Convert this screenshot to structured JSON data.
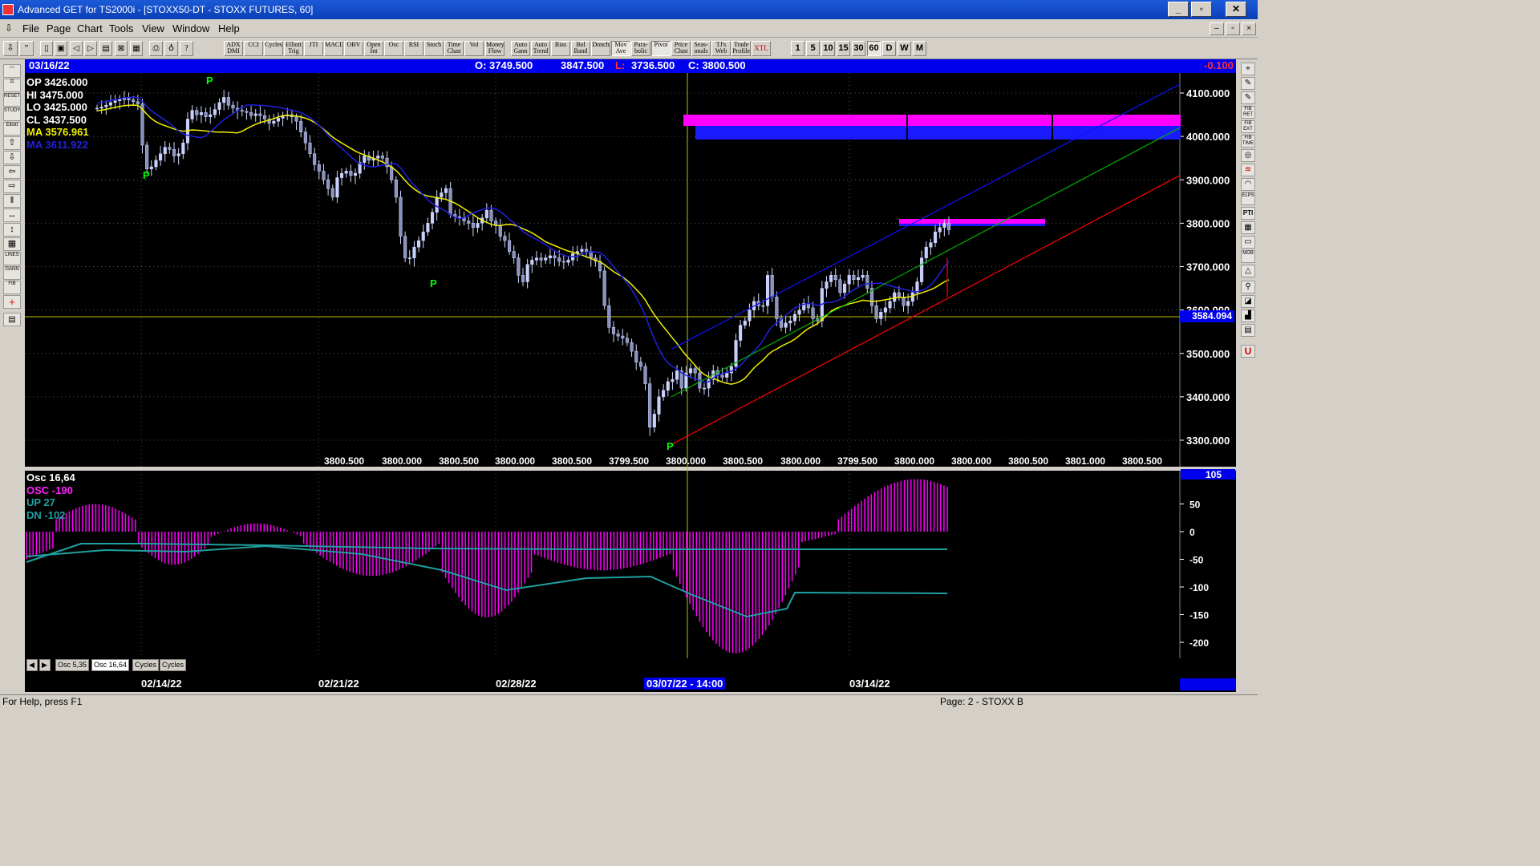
{
  "window": {
    "title": "Advanced GET for TS2000i - [STOXX50-DT - STOXX FUTURES, 60]"
  },
  "menu": [
    "File",
    "Page",
    "Chart",
    "Tools",
    "View",
    "Window",
    "Help"
  ],
  "toolbar": {
    "studies": [
      "ADX DMI",
      "CCI",
      "Cycles",
      "Elliott Trig",
      "JTI",
      "MACD",
      "OBV",
      "Open Int",
      "Osc",
      "RSI",
      "Stoch",
      "Time Clust",
      "Vol",
      "Money Flow",
      "Auto Gann",
      "Auto Trend",
      "Bias",
      "Bol Band",
      "Donch",
      "Mov Ave",
      "Para-bolic",
      "Pivot",
      "Price Clust",
      "Seas-onals",
      "TJ's Web",
      "Trade Profile",
      "XTL"
    ],
    "intervals": [
      "1",
      "5",
      "10",
      "15",
      "30",
      "60",
      "D",
      "W",
      "M"
    ],
    "selected_interval": "60"
  },
  "infobar": {
    "date": "03/16/22",
    "open": "O: 3749.500",
    "high": "3847.500",
    "low_label": "L:",
    "low": "3736.500",
    "close": "C: 3800.500",
    "change": "-0.100"
  },
  "legend": {
    "op": "OP  3426.000",
    "hi": "HI   3475.000",
    "lo": "LO  3425.000",
    "cl": "CL  3437.500",
    "ma1": "MA  3576.961",
    "ma2": "MA  3611.922"
  },
  "price_axis": {
    "ticks": [
      "4100.000",
      "4000.000",
      "3900.000",
      "3800.000",
      "3700.000",
      "3600.000",
      "3500.000",
      "3400.000",
      "3300.000"
    ],
    "cursor_value": "3584.094"
  },
  "bottom_values": [
    "3800.500",
    "3800.000",
    "3800.500",
    "3800.000",
    "3800.500",
    "3799.500",
    "3800.000",
    "3800.500",
    "3800.000",
    "3799.500",
    "3800.000",
    "3800.000",
    "3800.500",
    "3801.000",
    "3800.500"
  ],
  "pivot_label": "P",
  "oscillator": {
    "title": "Osc 16,64",
    "osc": "OSC -190",
    "up": "UP   27",
    "dn": "DN   -102",
    "axis_ticks": [
      "105",
      "50",
      "0",
      "-50",
      "-100",
      "-150",
      "-200"
    ]
  },
  "tabs": [
    "Osc 5,35",
    "Osc 16,64",
    "Cycles",
    "Cycles"
  ],
  "dates": [
    "02/14/22",
    "02/21/22",
    "02/28/22",
    "03/07/22 - 14:00",
    "03/14/22"
  ],
  "status": {
    "help": "For Help, press F1",
    "page": "Page: 2 - STOXX B"
  },
  "colors": {
    "up_bar": "#c8d0ff",
    "ma_yellow": "#f0f000",
    "ma_blue": "#2020e0",
    "channel_upper": "#1010ff",
    "channel_mid": "#00b000",
    "channel_lower": "#ff0000",
    "magenta": "#ff00ff",
    "cyan": "#20a0a0",
    "pivot": "#00ff00"
  }
}
